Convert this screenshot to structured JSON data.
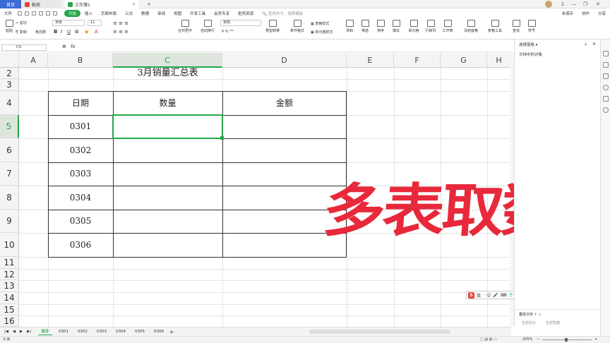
{
  "titlebar": {
    "tabs": [
      {
        "label": "首页"
      },
      {
        "label": "稻壳"
      },
      {
        "label": "工作簿1"
      }
    ],
    "new_tab": "+",
    "window_controls": [
      "1",
      "—",
      "❐",
      "✕"
    ]
  },
  "menubar": {
    "file": "文件",
    "items": [
      "开始",
      "插入",
      "页面布局",
      "公式",
      "数据",
      "审阅",
      "视图",
      "开发工具",
      "会员专享",
      "稻壳资源"
    ],
    "search_placeholder": "查找命令、搜索模板",
    "right": [
      "未保存",
      "协作",
      "分享"
    ]
  },
  "ribbon": {
    "cut": "剪切",
    "copy": "复制",
    "format_painter": "格式刷",
    "paste": "粘贴",
    "font_name": "宋体",
    "font_size": "11",
    "merge_center": "合并居中",
    "wrap": "自动换行",
    "number_format": "常规",
    "type_convert": "类型转换",
    "cond_format": "条件格式",
    "table_style": "表格样式",
    "cell_style": "单元格样式",
    "sum": "求和",
    "filter": "筛选",
    "sort": "排序",
    "fill": "填充",
    "cell": "单元格",
    "rowcol": "行和列",
    "worksheet": "工作表",
    "freeze": "冻结窗格",
    "table_tools": "表格工具",
    "find": "查找",
    "symbol": "符号"
  },
  "formulabar": {
    "name_box": "C5",
    "fx": "fx",
    "value": ""
  },
  "sheet": {
    "columns": [
      "A",
      "B",
      "C",
      "D",
      "E",
      "F",
      "G",
      "H"
    ],
    "rows": [
      "2",
      "3",
      "4",
      "5",
      "6",
      "7",
      "8",
      "9",
      "10",
      "11",
      "12",
      "13",
      "14",
      "15",
      "16"
    ],
    "selected_cell": "C5",
    "title": "3月销量汇总表",
    "headers": [
      "日期",
      "数量",
      "金额"
    ],
    "dates": [
      "0301",
      "0302",
      "0303",
      "0304",
      "0305",
      "0306"
    ]
  },
  "overlay_text": "多表取数",
  "ime": {
    "lang": "英",
    "logo": "S"
  },
  "sheet_tabs": [
    "总计",
    "0301",
    "0302",
    "0303",
    "0304",
    "0305",
    "0306"
  ],
  "sheet_tab_add": "+",
  "right_pane": {
    "title": "选择窗格",
    "subtitle": "文档中的对象",
    "order": "叠放次序",
    "show_all": "全部显示",
    "hide_all": "全部隐藏"
  },
  "status": {
    "zoom": "205%"
  },
  "colors": {
    "accent": "#27a74a",
    "overlay": "#e8293b",
    "home_tab": "#3a6cd8"
  }
}
